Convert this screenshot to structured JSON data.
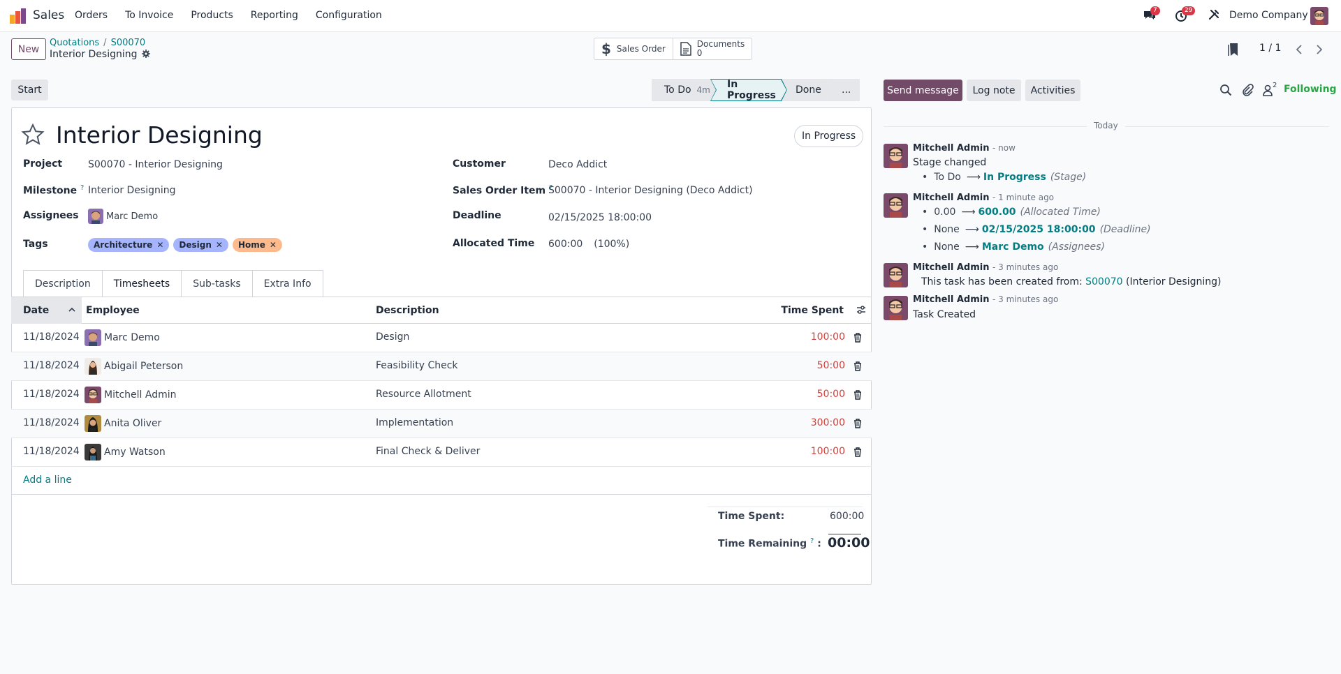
{
  "navbar": {
    "app_name": "Sales",
    "menu": [
      "Orders",
      "To Invoice",
      "Products",
      "Reporting",
      "Configuration"
    ],
    "messages_count": "7",
    "activities_count": "29",
    "company": "Demo Company"
  },
  "control": {
    "new_label": "New",
    "breadcrumb_root": "Quotations",
    "breadcrumb_order": "S00070",
    "record_name": "Interior Designing",
    "smart_sales_order": "Sales Order",
    "smart_documents_label": "Documents",
    "smart_documents_count": "0",
    "pager": "1 / 1"
  },
  "statusbar": {
    "start_label": "Start",
    "stages": [
      {
        "label": "To Do",
        "duration": "4m"
      },
      {
        "label": "In Progress"
      },
      {
        "label": "Done"
      },
      {
        "label": "..."
      }
    ]
  },
  "form": {
    "title": "Interior Designing",
    "state": "In Progress",
    "fields": {
      "project_label": "Project",
      "project": "S00070 - Interior Designing",
      "milestone_label": "Milestone",
      "milestone": "Interior Designing",
      "assignees_label": "Assignees",
      "assignee": "Marc Demo",
      "tags_label": "Tags",
      "tags": [
        {
          "name": "Architecture",
          "color": "#a5b4fc"
        },
        {
          "name": "Design",
          "color": "#a5b4fc"
        },
        {
          "name": "Home",
          "color": "#fdba8c"
        }
      ],
      "customer_label": "Customer",
      "customer": "Deco Addict",
      "sol_label": "Sales Order Item",
      "sol": "S00070 - Interior Designing (Deco Addict)",
      "deadline_label": "Deadline",
      "deadline": "02/15/2025 18:00:00",
      "allocated_label": "Allocated Time",
      "allocated": "600:00",
      "allocated_pct": "(100%)"
    },
    "tabs": [
      "Description",
      "Timesheets",
      "Sub-tasks",
      "Extra Info"
    ],
    "table": {
      "headers": {
        "date": "Date",
        "employee": "Employee",
        "description": "Description",
        "time": "Time Spent"
      },
      "rows": [
        {
          "date": "11/18/2024",
          "employee": "Marc Demo",
          "description": "Design",
          "time": "100:00"
        },
        {
          "date": "11/18/2024",
          "employee": "Abigail Peterson",
          "description": "Feasibility Check",
          "time": "50:00"
        },
        {
          "date": "11/18/2024",
          "employee": "Mitchell Admin",
          "description": "Resource Allotment",
          "time": "50:00"
        },
        {
          "date": "11/18/2024",
          "employee": "Anita Oliver",
          "description": "Implementation",
          "time": "300:00"
        },
        {
          "date": "11/18/2024",
          "employee": "Amy Watson",
          "description": "Final Check & Deliver",
          "time": "100:00"
        }
      ],
      "add_line": "Add a line"
    },
    "totals": {
      "spent_label": "Time Spent:",
      "spent": "600:00",
      "remaining_label": "Time Remaining",
      "remaining": "00:00"
    }
  },
  "chatter": {
    "send_label": "Send message",
    "log_label": "Log note",
    "activities_label": "Activities",
    "followers_count": "2",
    "following_label": "Following",
    "today_label": "Today",
    "messages": [
      {
        "author": "Mitchell Admin",
        "when": "- now",
        "body": "Stage changed",
        "tracking": [
          {
            "old": "To Do",
            "new": "In Progress",
            "field": "(Stage)"
          }
        ]
      },
      {
        "author": "Mitchell Admin",
        "when": "- 1 minute ago",
        "tracking": [
          {
            "old": "0.00",
            "new": "600.00",
            "field": "(Allocated Time)"
          },
          {
            "old": "None",
            "new": "02/15/2025 18:00:00",
            "field": "(Deadline)"
          },
          {
            "old": "None",
            "new": "Marc Demo",
            "field": "(Assignees)"
          }
        ]
      },
      {
        "author": "Mitchell Admin",
        "when": "- 3 minutes ago",
        "body_prefix": "This task has been created from:",
        "body_link": "S00070",
        "body_suffix": "(Interior Designing)"
      },
      {
        "author": "Mitchell Admin",
        "when": "- 3 minutes ago",
        "body": "Task Created"
      }
    ]
  }
}
